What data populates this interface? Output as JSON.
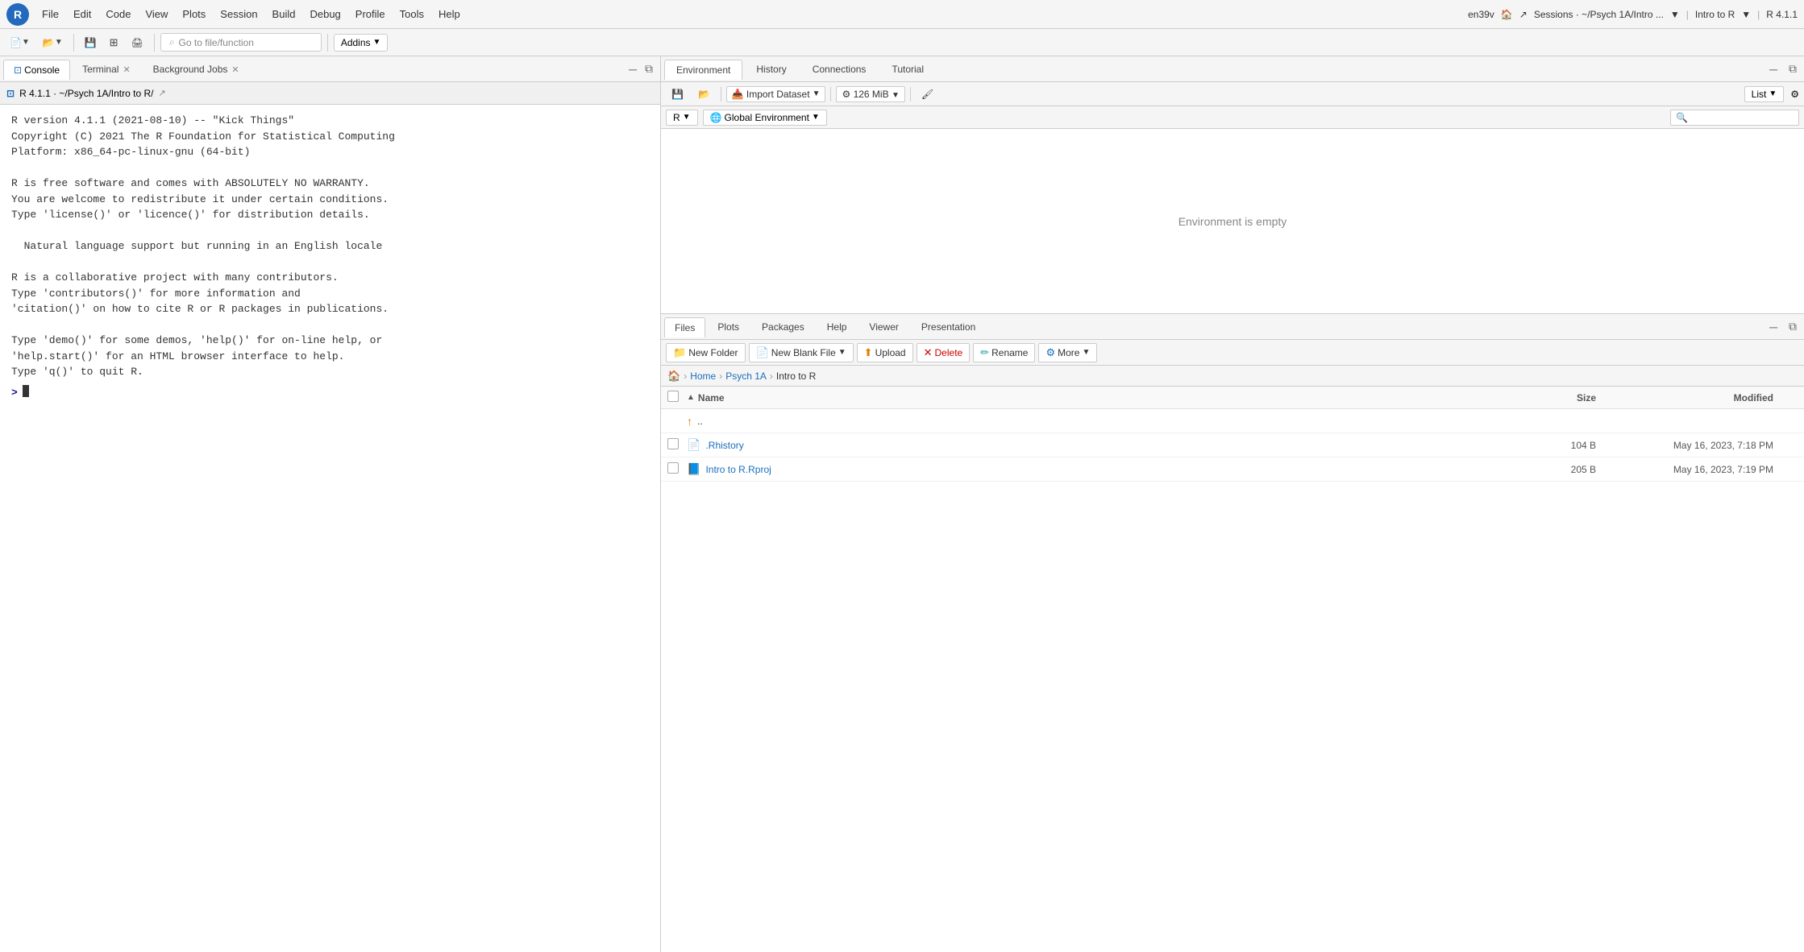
{
  "app": {
    "r_version_info": "en39v",
    "session_label": "Sessions · ~/Psych 1A/Intro ...",
    "intro_label": "Intro to R",
    "r_version_label": "R 4.1.1"
  },
  "menubar": {
    "logo": "R",
    "items": [
      "File",
      "Edit",
      "Code",
      "View",
      "Plots",
      "Session",
      "Build",
      "Debug",
      "Profile",
      "Tools",
      "Help"
    ]
  },
  "toolbar": {
    "go_to_file_placeholder": "Go to file/function",
    "addins_label": "Addins"
  },
  "left_pane": {
    "tabs": [
      {
        "label": "Console",
        "active": true,
        "closable": false
      },
      {
        "label": "Terminal",
        "active": false,
        "closable": true
      },
      {
        "label": "Background Jobs",
        "active": false,
        "closable": true
      }
    ],
    "console_path": "R 4.1.1 · ~/Psych 1A/Intro to R/",
    "console_output": "R version 4.1.1 (2021-08-10) -- \"Kick Things\"\nCopyright (C) 2021 The R Foundation for Statistical Computing\nPlatform: x86_64-pc-linux-gnu (64-bit)\n\nR is free software and comes with ABSOLUTELY NO WARRANTY.\nYou are welcome to redistribute it under certain conditions.\nType 'license()' or 'licence()' for distribution details.\n\n  Natural language support but running in an English locale\n\nR is a collaborative project with many contributors.\nType 'contributors()' for more information and\n'citation()' on how to cite R or R packages in publications.\n\nType 'demo()' for some demos, 'help()' for on-line help, or\n'help.start()' for an HTML browser interface to help.\nType 'q()' to quit R."
  },
  "right_upper": {
    "tabs": [
      {
        "label": "Environment",
        "active": true
      },
      {
        "label": "History",
        "active": false
      },
      {
        "label": "Connections",
        "active": false
      },
      {
        "label": "Tutorial",
        "active": false
      }
    ],
    "toolbar": {
      "import_label": "Import Dataset",
      "memory_label": "126 MiB",
      "list_label": "List"
    },
    "r_dropdown": "R",
    "global_env": "Global Environment",
    "env_empty_text": "Environment is empty"
  },
  "right_lower": {
    "tabs": [
      {
        "label": "Files",
        "active": true
      },
      {
        "label": "Plots",
        "active": false
      },
      {
        "label": "Packages",
        "active": false
      },
      {
        "label": "Help",
        "active": false
      },
      {
        "label": "Viewer",
        "active": false
      },
      {
        "label": "Presentation",
        "active": false
      }
    ],
    "files_toolbar": {
      "new_folder": "New Folder",
      "new_blank_file": "New Blank File",
      "upload": "Upload",
      "delete": "Delete",
      "rename": "Rename",
      "more": "More"
    },
    "breadcrumb": {
      "home_icon": "🏠",
      "items": [
        "Home",
        "Psych 1A",
        "Intro to R"
      ]
    },
    "columns": {
      "name": "Name",
      "size": "Size",
      "modified": "Modified"
    },
    "files": [
      {
        "name": "..",
        "type": "parent",
        "size": "",
        "modified": "",
        "icon": "↑"
      },
      {
        "name": ".Rhistory",
        "type": "rhistory",
        "size": "104 B",
        "modified": "May 16, 2023, 7:18 PM",
        "icon": "📄"
      },
      {
        "name": "Intro to R.Rproj",
        "type": "rproj",
        "size": "205 B",
        "modified": "May 16, 2023, 7:19 PM",
        "icon": "📘"
      }
    ]
  }
}
